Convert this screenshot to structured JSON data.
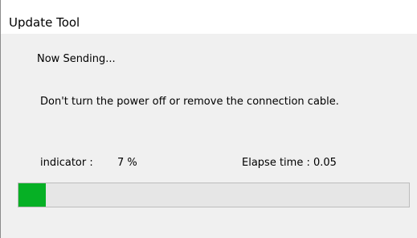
{
  "window": {
    "title": "Update Tool"
  },
  "status": {
    "message": "Now Sending...",
    "warning": "Don't turn the power off  or  remove the connection cable."
  },
  "progress": {
    "indicator_label": "indicator :",
    "percent_text": "7 %",
    "fraction": 0.07,
    "elapsed_text": "Elapse time : 0.05",
    "fill_color": "#06b025"
  }
}
